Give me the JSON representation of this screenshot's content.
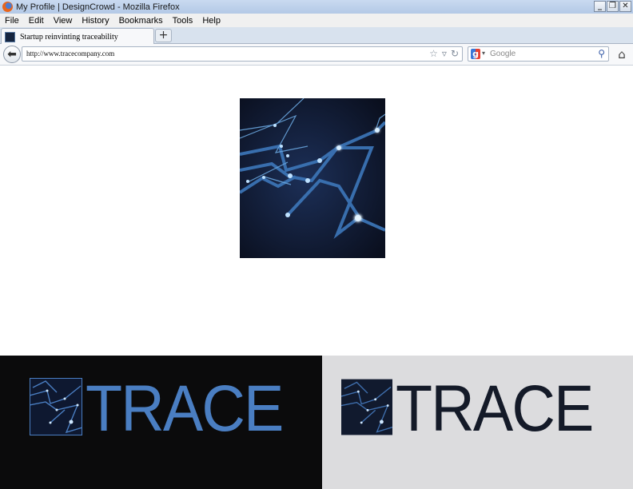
{
  "window": {
    "title": "My Profile | DesignCrowd - Mozilla Firefox",
    "controls": [
      "_",
      "❐",
      "✕"
    ]
  },
  "menu": [
    "File",
    "Edit",
    "View",
    "History",
    "Bookmarks",
    "Tools",
    "Help"
  ],
  "tabs": [
    {
      "label": "Startup reinvinting traceability"
    }
  ],
  "newtab_label": "+",
  "navbar": {
    "url": "http://www.tracecompany.com",
    "search_placeholder": "Google",
    "back_glyph": "⬅",
    "home_glyph": "⌂"
  },
  "content": {
    "logo_dark": {
      "word": "TRACE"
    },
    "logo_light": {
      "word": "TRACE"
    }
  },
  "colors": {
    "accent_blue": "#4a7ec2",
    "dark_navy": "#141a28",
    "panel_light": "#dcdcde",
    "panel_dark": "#0b0b0c"
  }
}
